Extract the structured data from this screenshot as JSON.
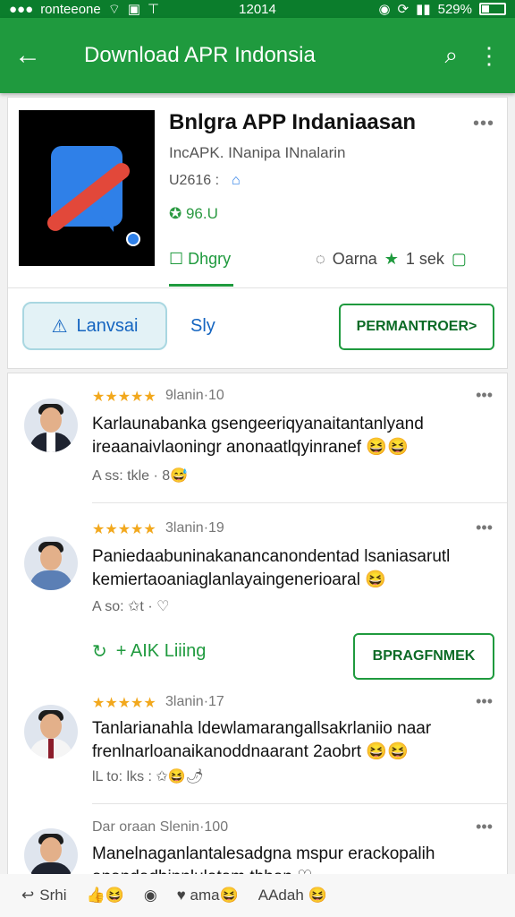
{
  "status_bar": {
    "carrier": "ronteeone",
    "time": "12014",
    "battery": "529%"
  },
  "app_bar": {
    "title": "Download APR Indonsia"
  },
  "app_card": {
    "name": "Bnlgra APP Indaniaasan",
    "developer": "IncAPK.  INanipa INnalarin",
    "size": "U2616 :",
    "rating": "96.U",
    "tab_primary": "Dhgry",
    "tab_secondary": "Oarna",
    "tab_count": "1 sek",
    "btn_left": "Lanvsai",
    "btn_mid": "Sly",
    "btn_install": "PERMANTROER>"
  },
  "reviews": [
    {
      "stars": "★★★★★",
      "date": "9lanin·10",
      "text": "Karlaunabanka gsengeeriqyanaitantanlyand ireaanaivlaoningr anonaatlqyinranef 😆😆",
      "meta": "A ss: tkle · 8😅"
    },
    {
      "stars": "★★★★★",
      "date": "3lanin·19",
      "text": "Paniedaabuninakanancanondentad lsaniasarutl kemiertaoaniaglanlayaingenerioaral 😆",
      "meta": "A so: ✩t · ♡"
    },
    {
      "stars": "★★★★★",
      "date": "3lanin·17",
      "text": "Tanlarianahla ldewlamarangallsakrlaniio naar frenlnarloanaikanoddnaarant 2aobrt 😆😆",
      "meta": "lL to: lks : ✩😆🌶"
    },
    {
      "stars": "",
      "date": "Dar oraan Slenin·100",
      "text": "Manelnaganlantalesadgna mspur erackopalih anandadhinnlulatam thhan ♡",
      "meta": ""
    }
  ],
  "link_row": {
    "label": "+ AIK Liiing"
  },
  "btn_report": {
    "label": "BPRAGFNMEK"
  },
  "bottom_bar": {
    "item1": "Srhi",
    "item2": "👍😆",
    "item3": "◉",
    "item4": "♥ ama😆",
    "item5": "AAdah 😆"
  }
}
